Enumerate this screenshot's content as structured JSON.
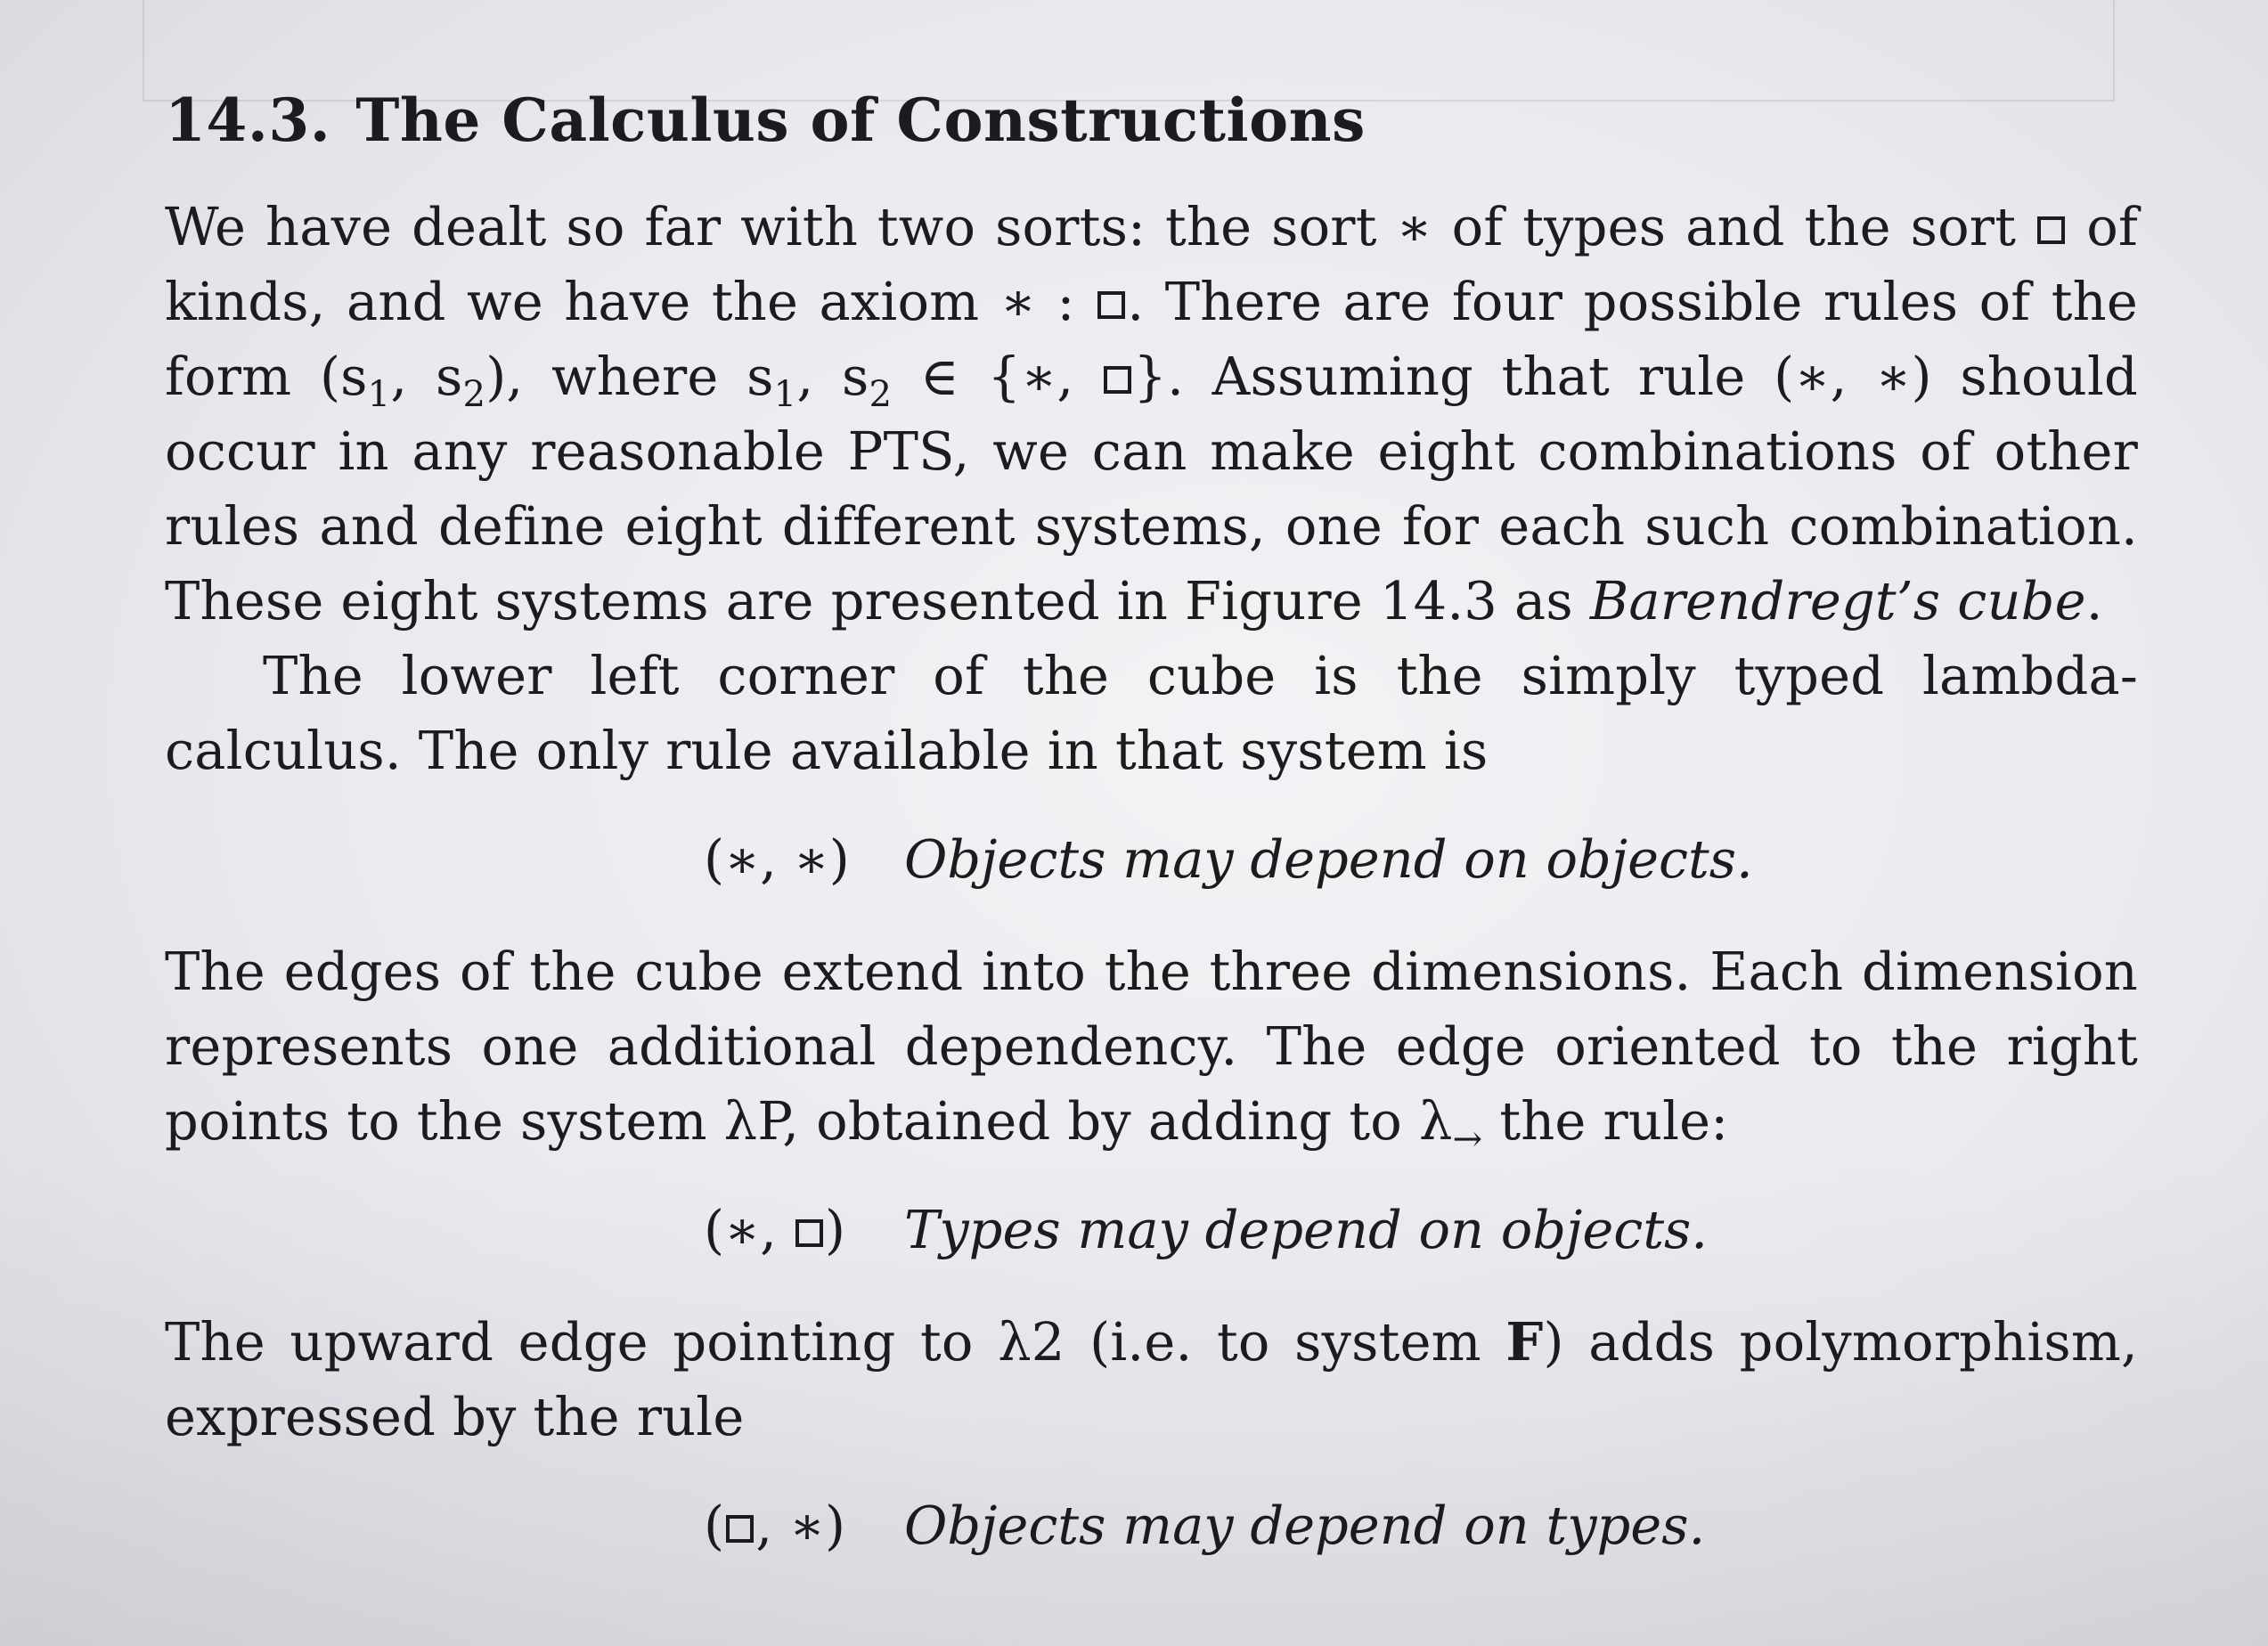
{
  "section": {
    "number": "14.3.",
    "title": "The Calculus of Constructions"
  },
  "p1": {
    "a": "We have dealt so far with two sorts: the sort ∗ of types and the sort ",
    "b": " of kinds, and we have the axiom ∗ : ",
    "c": ". There are four possible rules of the form (s",
    "sub1": "1",
    "d": ", s",
    "sub2": "2",
    "e": "), where s",
    "sub3": "1",
    "f": ", s",
    "sub4": "2",
    "g": " ∈ {∗, ",
    "h": "}. Assuming that rule (∗, ∗) should occur in any reasonable PTS, we can make eight combinations of other rules and define eight different systems, one for each such combination. These eight systems are presented in Figure 14.3 as ",
    "cube_italic": "Barendregt’s cube",
    "end": "."
  },
  "p2": "The lower left corner of the cube is the simply typed lambda-calculus. The only rule available in that system is",
  "rule1": {
    "label": "(∗, ∗)",
    "desc": "Objects may depend on objects."
  },
  "p3": {
    "text": "The edges of the cube extend into the three dimensions. Each dimension represents one additional dependency. The edge oriented to the right points to the system λP, obtained by adding to λ",
    "sub_arrow": "→",
    "end": " the rule:"
  },
  "rule2": {
    "label_open": "(∗, ",
    "label_close": ")",
    "desc": "Types may depend on objects."
  },
  "p4": {
    "a": "The upward edge pointing to λ2 (i.e. to system ",
    "bold_F": "F",
    "b": ") adds polymorphism, expressed by the rule"
  },
  "rule3": {
    "label_open": "(",
    "label_close": ", ∗)",
    "desc": "Objects may depend on types."
  },
  "icons": {
    "box_symbol": "box-sort-symbol"
  }
}
